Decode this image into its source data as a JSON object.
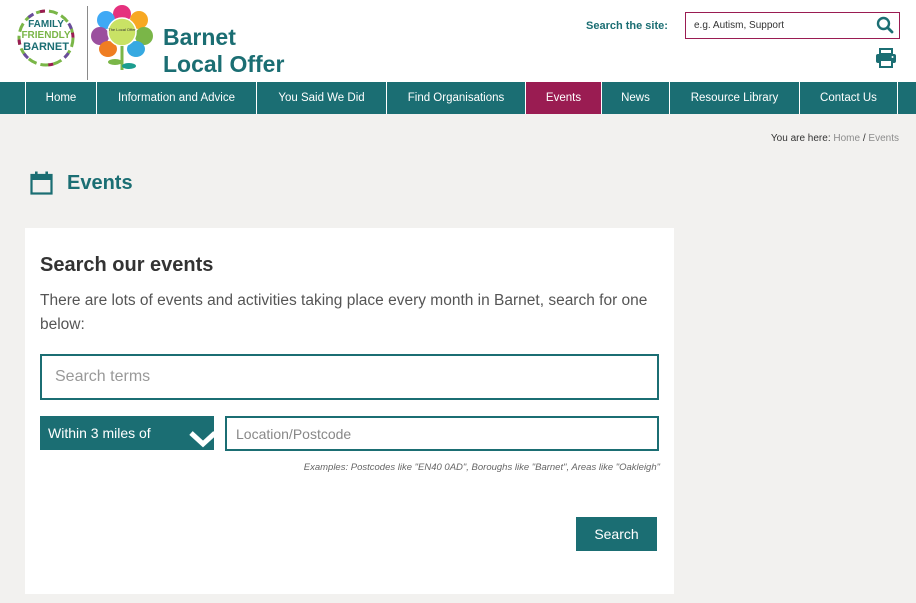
{
  "header": {
    "family_logo": {
      "line1": "FAMILY",
      "line2": "FRIENDLY",
      "line3": "BARNET"
    },
    "flower_text": "The Local Offer",
    "title_line1": "Barnet",
    "title_line2": "Local Offer",
    "search_label": "Search the site:",
    "search_placeholder": "e.g. Autism, Support"
  },
  "nav": {
    "items": [
      {
        "label": "Home",
        "active": false
      },
      {
        "label": "Information and Advice",
        "active": false
      },
      {
        "label": "You Said We Did",
        "active": false
      },
      {
        "label": "Find Organisations",
        "active": false
      },
      {
        "label": "Events",
        "active": true
      },
      {
        "label": "News",
        "active": false
      },
      {
        "label": "Resource Library",
        "active": false
      },
      {
        "label": "Contact Us",
        "active": false
      }
    ]
  },
  "breadcrumb": {
    "prefix": "You are here:",
    "home": "Home",
    "separator": "/",
    "current": "Events"
  },
  "page": {
    "title": "Events"
  },
  "card": {
    "heading": "Search our events",
    "intro": "There are lots of events and activities taking place every month in Barnet, search for one below:",
    "terms_placeholder": "Search terms",
    "distance_selected": "Within 3 miles of",
    "location_placeholder": "Location/Postcode",
    "examples_hint": "Examples: Postcodes like \"EN40 0AD\", Boroughs like \"Barnet\", Areas like \"Oakleigh\"",
    "search_button": "Search"
  },
  "colors": {
    "brand_teal": "#1b6e73",
    "accent_magenta": "#9a1c52",
    "page_bg": "#f2f1ef",
    "card_bg": "#ffffff"
  },
  "icons": [
    "search-icon",
    "print-icon",
    "calendar-icon",
    "chevron-down-icon"
  ]
}
